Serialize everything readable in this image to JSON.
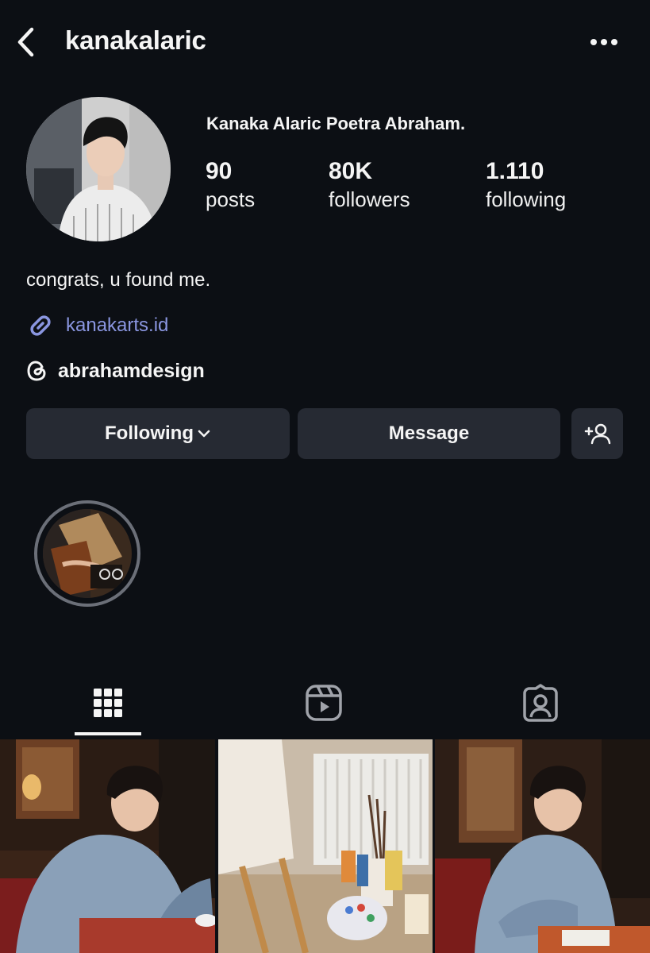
{
  "header": {
    "username": "kanakalaric",
    "back_icon": "chevron-left-icon",
    "more_icon": "more-horizontal-icon"
  },
  "profile": {
    "display_name": "Kanaka Alaric Poetra Abraham.",
    "stats": [
      {
        "value": "90",
        "label": "posts"
      },
      {
        "value": "80K",
        "label": "followers"
      },
      {
        "value": "1.110",
        "label": "following"
      }
    ],
    "bio": "congrats, u found me.",
    "link": "kanakarts.id",
    "threads_handle": "abrahamdesign"
  },
  "actions": {
    "following_label": "Following",
    "message_label": "Message"
  },
  "tabs": [
    "grid-icon",
    "reels-icon",
    "tagged-icon"
  ],
  "colors": {
    "background": "#0c0f14",
    "button": "#262a33",
    "link": "#8a96e0"
  }
}
